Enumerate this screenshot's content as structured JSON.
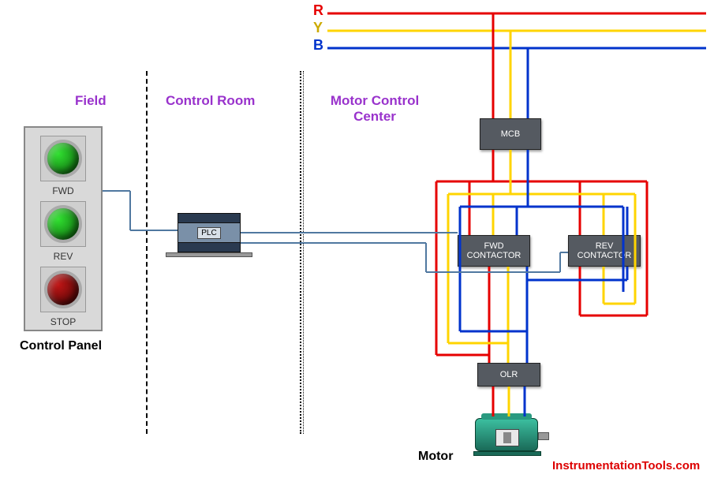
{
  "sections": {
    "field": "Field",
    "control_room": "Control Room",
    "mcc": "Motor Control Center"
  },
  "phases": {
    "r": "R",
    "y": "Y",
    "b": "B"
  },
  "panel": {
    "caption": "Control Panel"
  },
  "buttons": {
    "fwd": "FWD",
    "rev": "REV",
    "stop": "STOP"
  },
  "units": {
    "plc": "PLC",
    "mcb": "MCB",
    "fwd_contactor": "FWD CONTACTOR",
    "rev_contactor": "REV CONTACTOR",
    "olr": "OLR"
  },
  "motor": {
    "caption": "Motor"
  },
  "footer": {
    "watermark": "InstrumentationTools.com"
  },
  "colors": {
    "r": "#e60000",
    "y": "#ffd400",
    "b": "#0033cc",
    "signal": "#5078a0"
  }
}
